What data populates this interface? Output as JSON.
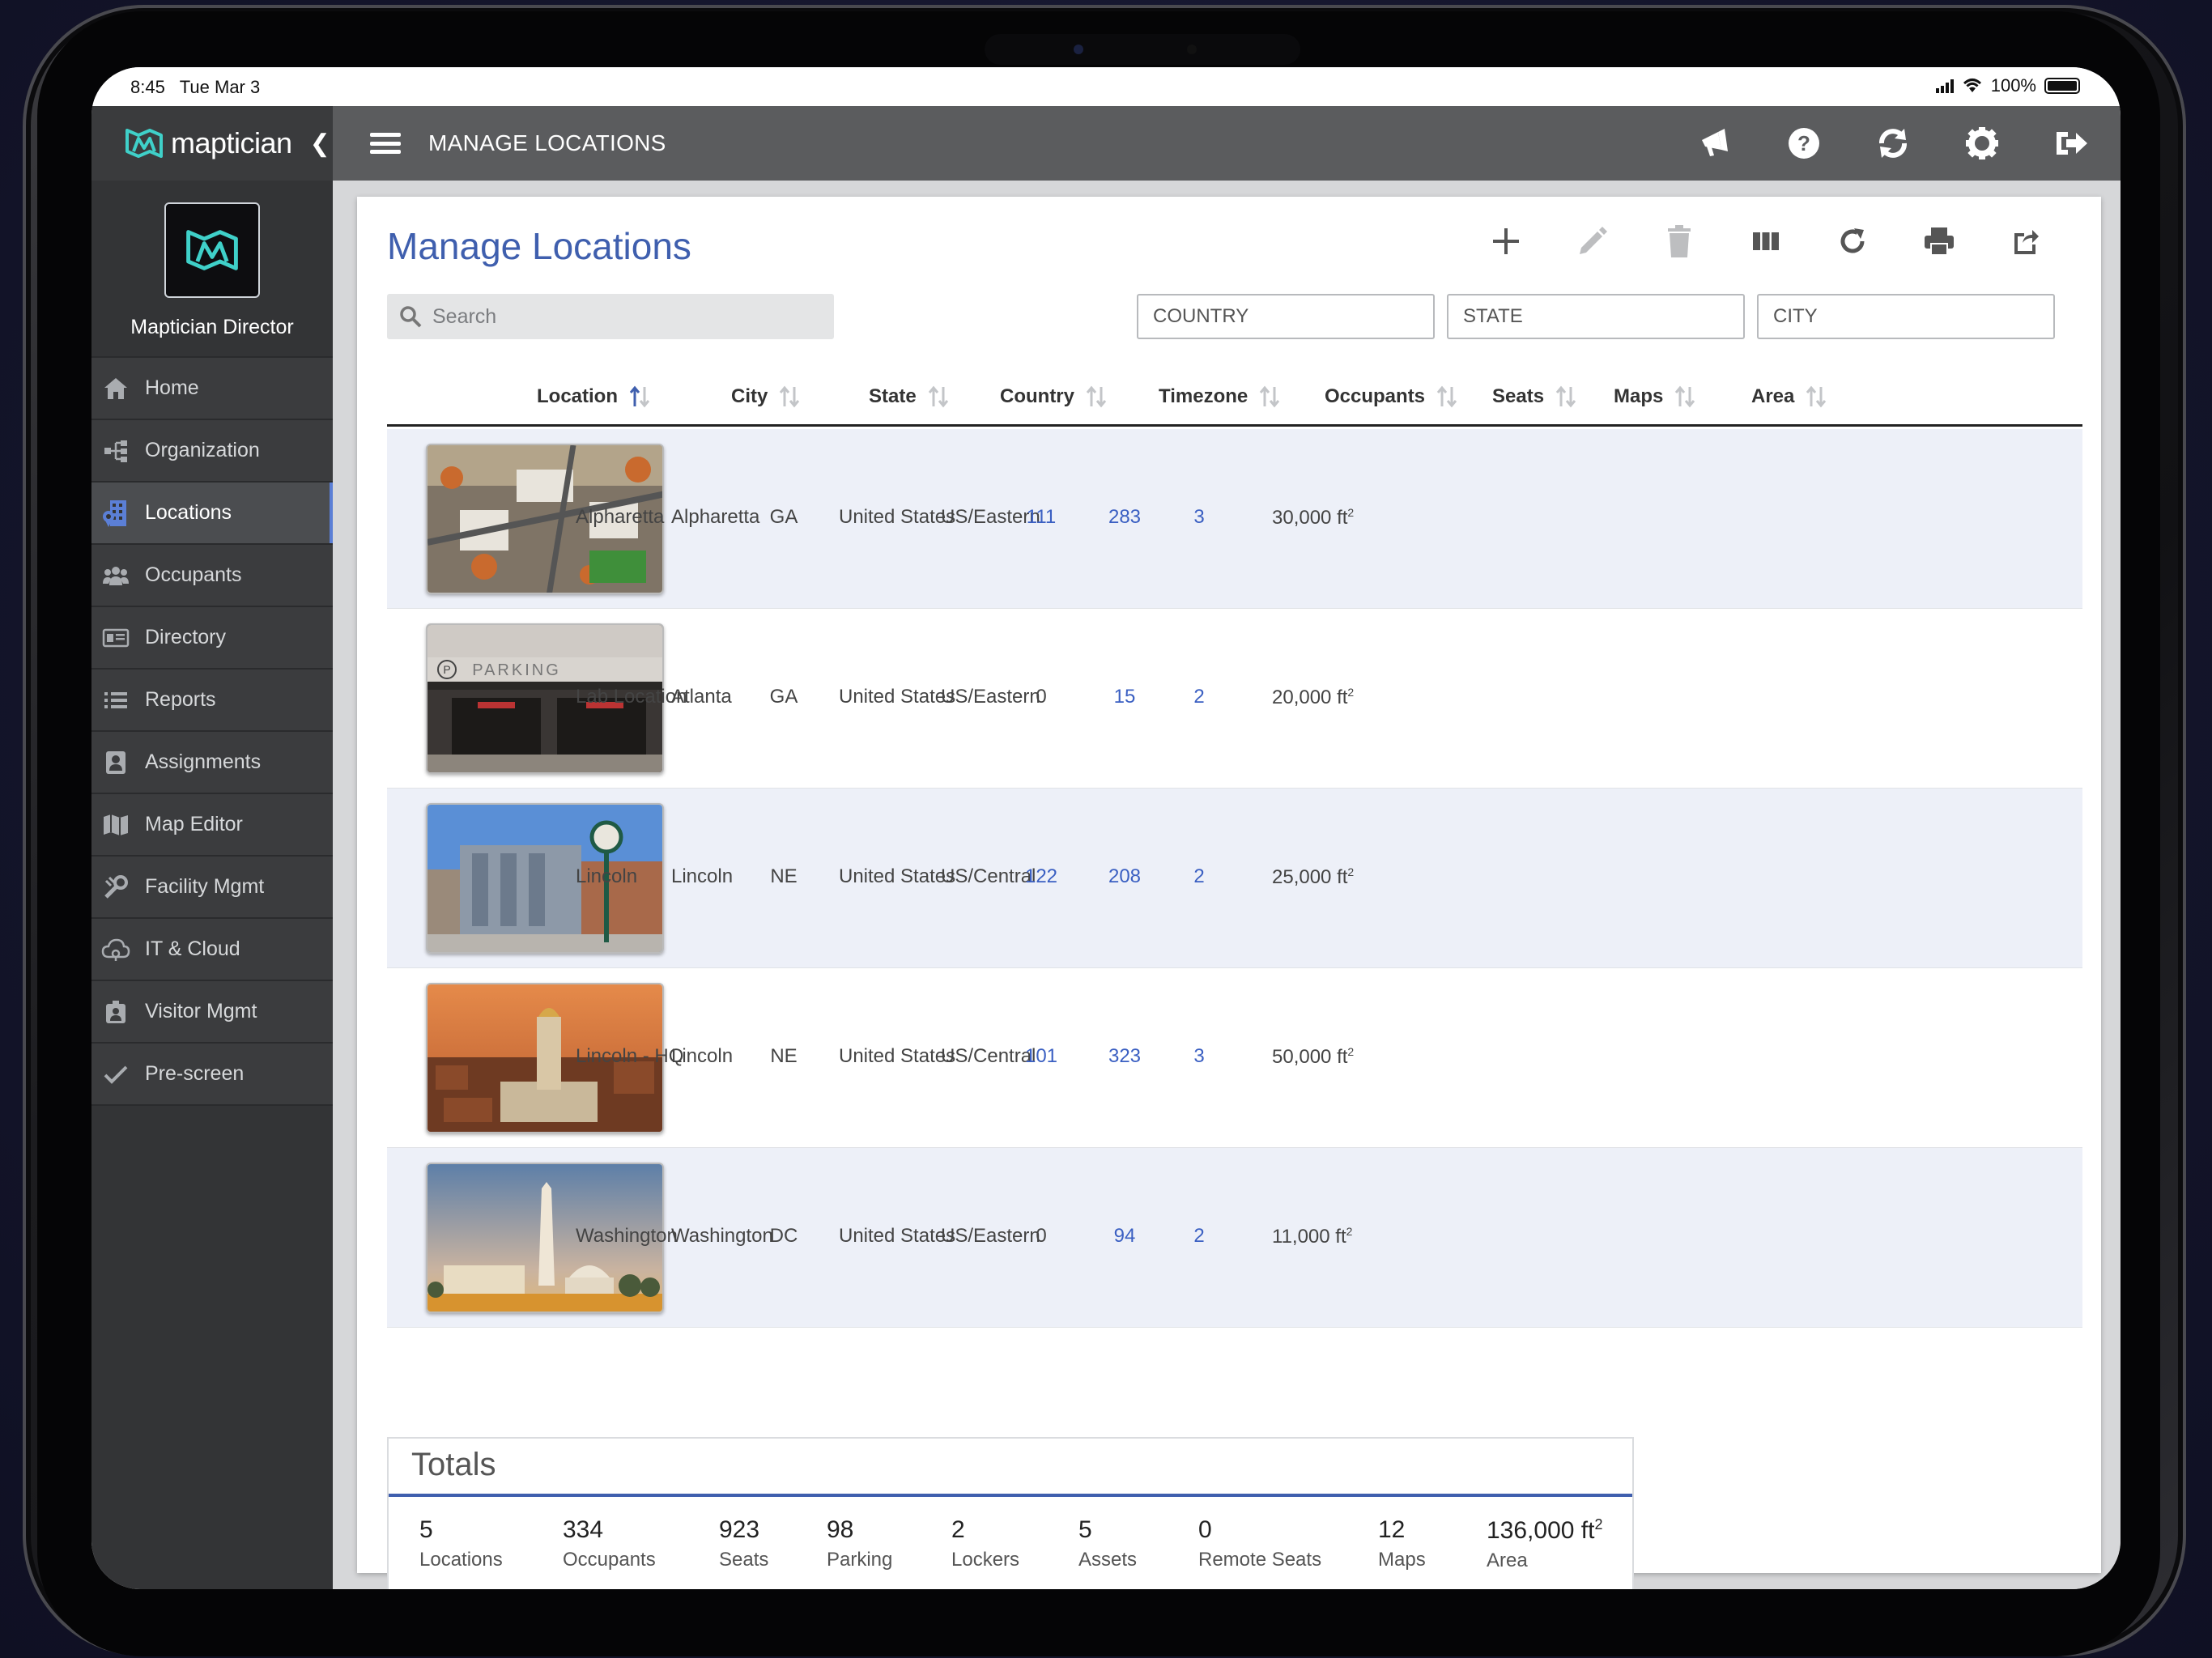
{
  "status": {
    "time": "8:45",
    "date": "Tue Mar 3",
    "battery": "100%"
  },
  "brand": {
    "name": "maptician"
  },
  "org": {
    "name": "Maptician Director"
  },
  "sidebar": {
    "items": [
      {
        "label": "Home",
        "icon": "home-icon"
      },
      {
        "label": "Organization",
        "icon": "org-chart-icon"
      },
      {
        "label": "Locations",
        "icon": "building-icon",
        "active": true
      },
      {
        "label": "Occupants",
        "icon": "people-icon"
      },
      {
        "label": "Directory",
        "icon": "id-card-icon"
      },
      {
        "label": "Reports",
        "icon": "list-icon"
      },
      {
        "label": "Assignments",
        "icon": "badge-icon"
      },
      {
        "label": "Map Editor",
        "icon": "map-icon"
      },
      {
        "label": "Facility Mgmt",
        "icon": "tools-icon"
      },
      {
        "label": "IT & Cloud",
        "icon": "cloud-icon"
      },
      {
        "label": "Visitor Mgmt",
        "icon": "visitor-icon"
      },
      {
        "label": "Pre-screen",
        "icon": "check-icon"
      }
    ]
  },
  "header": {
    "title": "MANAGE LOCATIONS"
  },
  "page": {
    "title": "Manage Locations",
    "search_placeholder": "Search",
    "filters": {
      "country": "COUNTRY",
      "state": "STATE",
      "city": "CITY"
    }
  },
  "table": {
    "columns": [
      "Location",
      "City",
      "State",
      "Country",
      "Timezone",
      "Occupants",
      "Seats",
      "Maps",
      "Area"
    ],
    "rows": [
      {
        "location": "Alpharetta",
        "city": "Alpharetta",
        "state": "GA",
        "country": "United States",
        "timezone": "US/Eastern",
        "occupants": "111",
        "seats": "283",
        "maps": "3",
        "area": "30,000 ft"
      },
      {
        "location": "Lab Location",
        "city": "Atlanta",
        "state": "GA",
        "country": "United States",
        "timezone": "US/Eastern",
        "occupants": "0",
        "seats": "15",
        "maps": "2",
        "area": "20,000 ft",
        "thumb_text": "PARKING"
      },
      {
        "location": "Lincoln",
        "city": "Lincoln",
        "state": "NE",
        "country": "United States",
        "timezone": "US/Central",
        "occupants": "122",
        "seats": "208",
        "maps": "2",
        "area": "25,000 ft"
      },
      {
        "location": "Lincoln - HQ",
        "city": "Lincoln",
        "state": "NE",
        "country": "United States",
        "timezone": "US/Central",
        "occupants": "101",
        "seats": "323",
        "maps": "3",
        "area": "50,000 ft"
      },
      {
        "location": "Washington",
        "city": "Washington",
        "state": "DC",
        "country": "United States",
        "timezone": "US/Eastern",
        "occupants": "0",
        "seats": "94",
        "maps": "2",
        "area": "11,000 ft"
      }
    ],
    "area_superscript": "2"
  },
  "totals": {
    "title": "Totals",
    "items": [
      {
        "value": "5",
        "label": "Locations"
      },
      {
        "value": "334",
        "label": "Occupants"
      },
      {
        "value": "923",
        "label": "Seats"
      },
      {
        "value": "98",
        "label": "Parking"
      },
      {
        "value": "2",
        "label": "Lockers"
      },
      {
        "value": "5",
        "label": "Assets"
      },
      {
        "value": "0",
        "label": "Remote Seats"
      },
      {
        "value": "12",
        "label": "Maps"
      },
      {
        "value": "136,000 ft",
        "label": "Area"
      }
    ]
  },
  "colors": {
    "accent": "#3f5fae",
    "link": "#3a5fc2",
    "sidebar": "#333436",
    "topbar": "#5b5c5e"
  }
}
